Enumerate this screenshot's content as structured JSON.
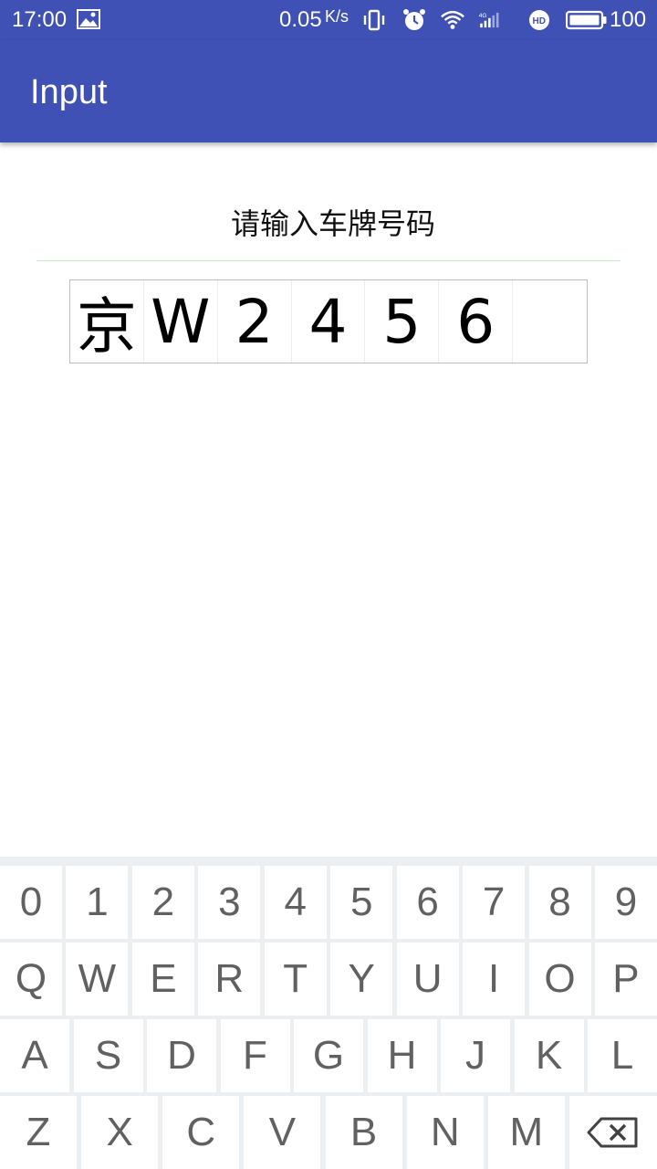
{
  "status_bar": {
    "time": "17:00",
    "speed": "0.05",
    "speed_unit": "K/s",
    "battery": "100"
  },
  "app_bar": {
    "title": "Input"
  },
  "prompt": "请输入车牌号码",
  "plate": {
    "chars": [
      "京",
      "W",
      "2",
      "4",
      "5",
      "6",
      ""
    ]
  },
  "keyboard": {
    "row1": [
      "0",
      "1",
      "2",
      "3",
      "4",
      "5",
      "6",
      "7",
      "8",
      "9"
    ],
    "row2": [
      "Q",
      "W",
      "E",
      "R",
      "T",
      "Y",
      "U",
      "I",
      "O",
      "P"
    ],
    "row3": [
      "A",
      "S",
      "D",
      "F",
      "G",
      "H",
      "J",
      "K",
      "L"
    ],
    "row4": [
      "Z",
      "X",
      "C",
      "V",
      "B",
      "N",
      "M"
    ],
    "backspace_icon": "backspace-icon"
  },
  "colors": {
    "primary": "#3f51b5",
    "key_text": "#616161",
    "keyboard_bg": "#eceff1"
  }
}
